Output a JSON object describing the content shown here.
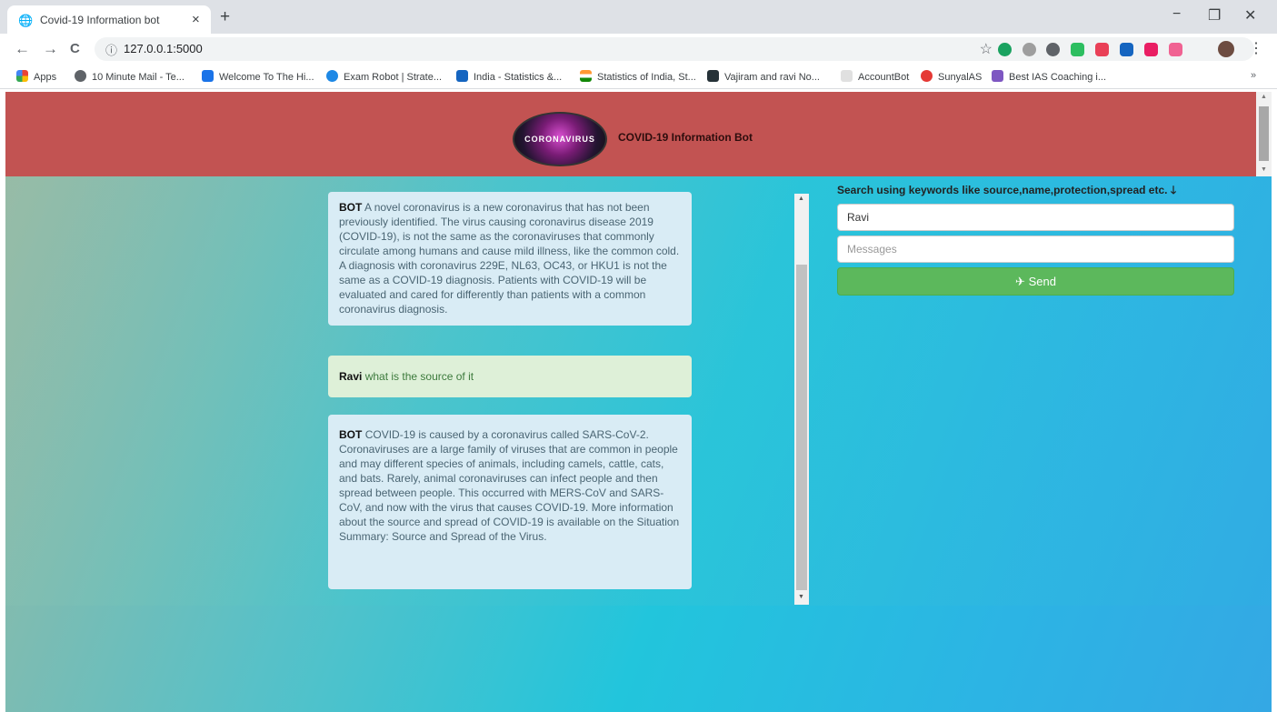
{
  "browser": {
    "tab_title": "Covid-19 Information bot",
    "tab_close": "×",
    "new_tab": "+",
    "url": "127.0.0.1:5000",
    "window_controls": {
      "minimize": "−",
      "maximize": "❐",
      "close": "✕"
    },
    "nav": {
      "back": "←",
      "forward": "→",
      "reload": "C"
    },
    "star_icon": "☆",
    "menu_icon": "⋮",
    "bookmarks": [
      {
        "label": "Apps",
        "color": "#ea4335"
      },
      {
        "label": "10 Minute Mail - Te...",
        "color": "#5f6368"
      },
      {
        "label": "Welcome To The Hi...",
        "color": "#1a73e8"
      },
      {
        "label": "Exam Robot | Strate...",
        "color": "#1e88e5"
      },
      {
        "label": "India - Statistics &...",
        "color": "#1565c0"
      },
      {
        "label": "Statistics of India, St...",
        "color": "#e65100"
      },
      {
        "label": "Vajiram and ravi No...",
        "color": "#263238"
      },
      {
        "label": "AccountBot",
        "color": "#bdbdbd"
      },
      {
        "label": "SunyalAS",
        "color": "#e53935"
      },
      {
        "label": "Best IAS Coaching i...",
        "color": "#7e57c2"
      }
    ],
    "bookmarks_overflow": "»"
  },
  "header": {
    "logo_text": "CORONAVIRUS",
    "title": "COVID-19 Information Bot",
    "bg_color": "#c25352"
  },
  "chat": {
    "messages": [
      {
        "sender": "BOT",
        "text": "A novel coronavirus is a new coronavirus that has not been previously identified. The virus causing coronavirus disease 2019 (COVID-19), is not the same as the coronaviruses that commonly circulate among humans and cause mild illness, like the common cold. A diagnosis with coronavirus 229E, NL63, OC43, or HKU1 is not the same as a COVID-19 diagnosis. Patients with COVID-19 will be evaluated and cared for differently than patients with a common coronavirus diagnosis."
      },
      {
        "sender": "Ravi",
        "text": "what is the source of it"
      },
      {
        "sender": "BOT",
        "text": "COVID-19 is caused by a coronavirus called SARS-CoV-2. Coronaviruses are a large family of viruses that are common in people and may different species of animals, including camels, cattle, cats, and bats. Rarely, animal coronaviruses can infect people and then spread between people. This occurred with MERS-CoV and SARS-CoV, and now with the virus that causes COVID-19. More information about the source and spread of COVID-19 is available on the Situation Summary: Source and Spread of the Virus."
      }
    ]
  },
  "form": {
    "hint": "Search using keywords like source,name,protection,spread etc.",
    "hint_arrow": "🡓",
    "name_value": "Ravi",
    "message_placeholder": "Messages",
    "send_label": "Send",
    "send_icon": "✈",
    "send_color": "#5cb85c"
  }
}
